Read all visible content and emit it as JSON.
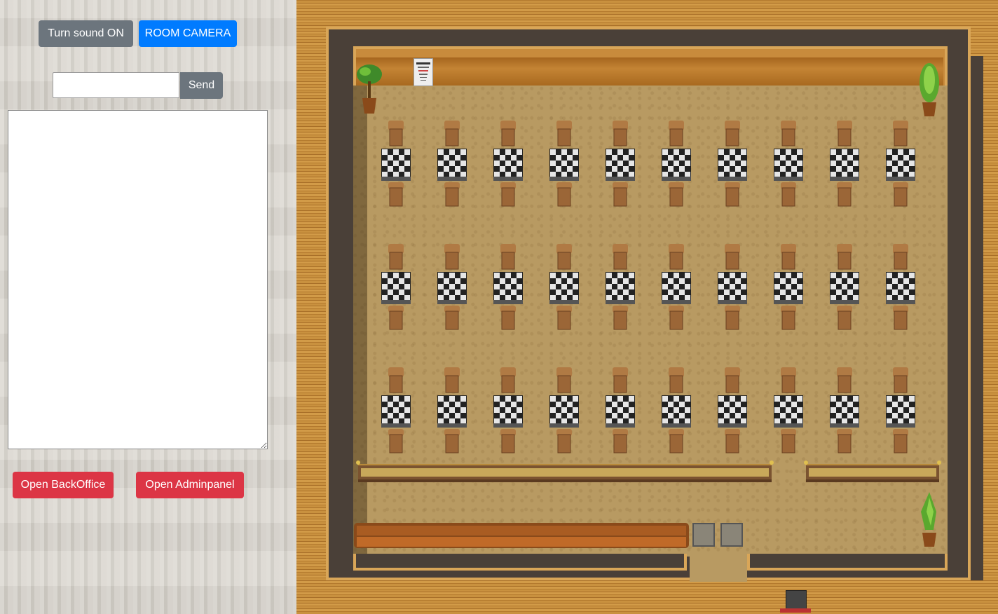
{
  "controls": {
    "sound_label": "Turn sound ON",
    "camera_label": "ROOM CAMERA",
    "send_label": "Send",
    "chat_input_value": "",
    "chat_log_value": "",
    "backoffice_label": "Open BackOffice",
    "admin_label": "Open Adminpanel"
  },
  "colors": {
    "gray_button": "#6c757d",
    "blue_button": "#007bff",
    "red_button": "#dc3545"
  },
  "room": {
    "rows_of_desks": 3,
    "desks_per_row": 10,
    "icons": [
      "plant-icon",
      "eye-chart-icon",
      "chair-icon",
      "desk-icon",
      "railing-icon",
      "sofa-icon",
      "crate-icon",
      "avatar-icon"
    ]
  }
}
